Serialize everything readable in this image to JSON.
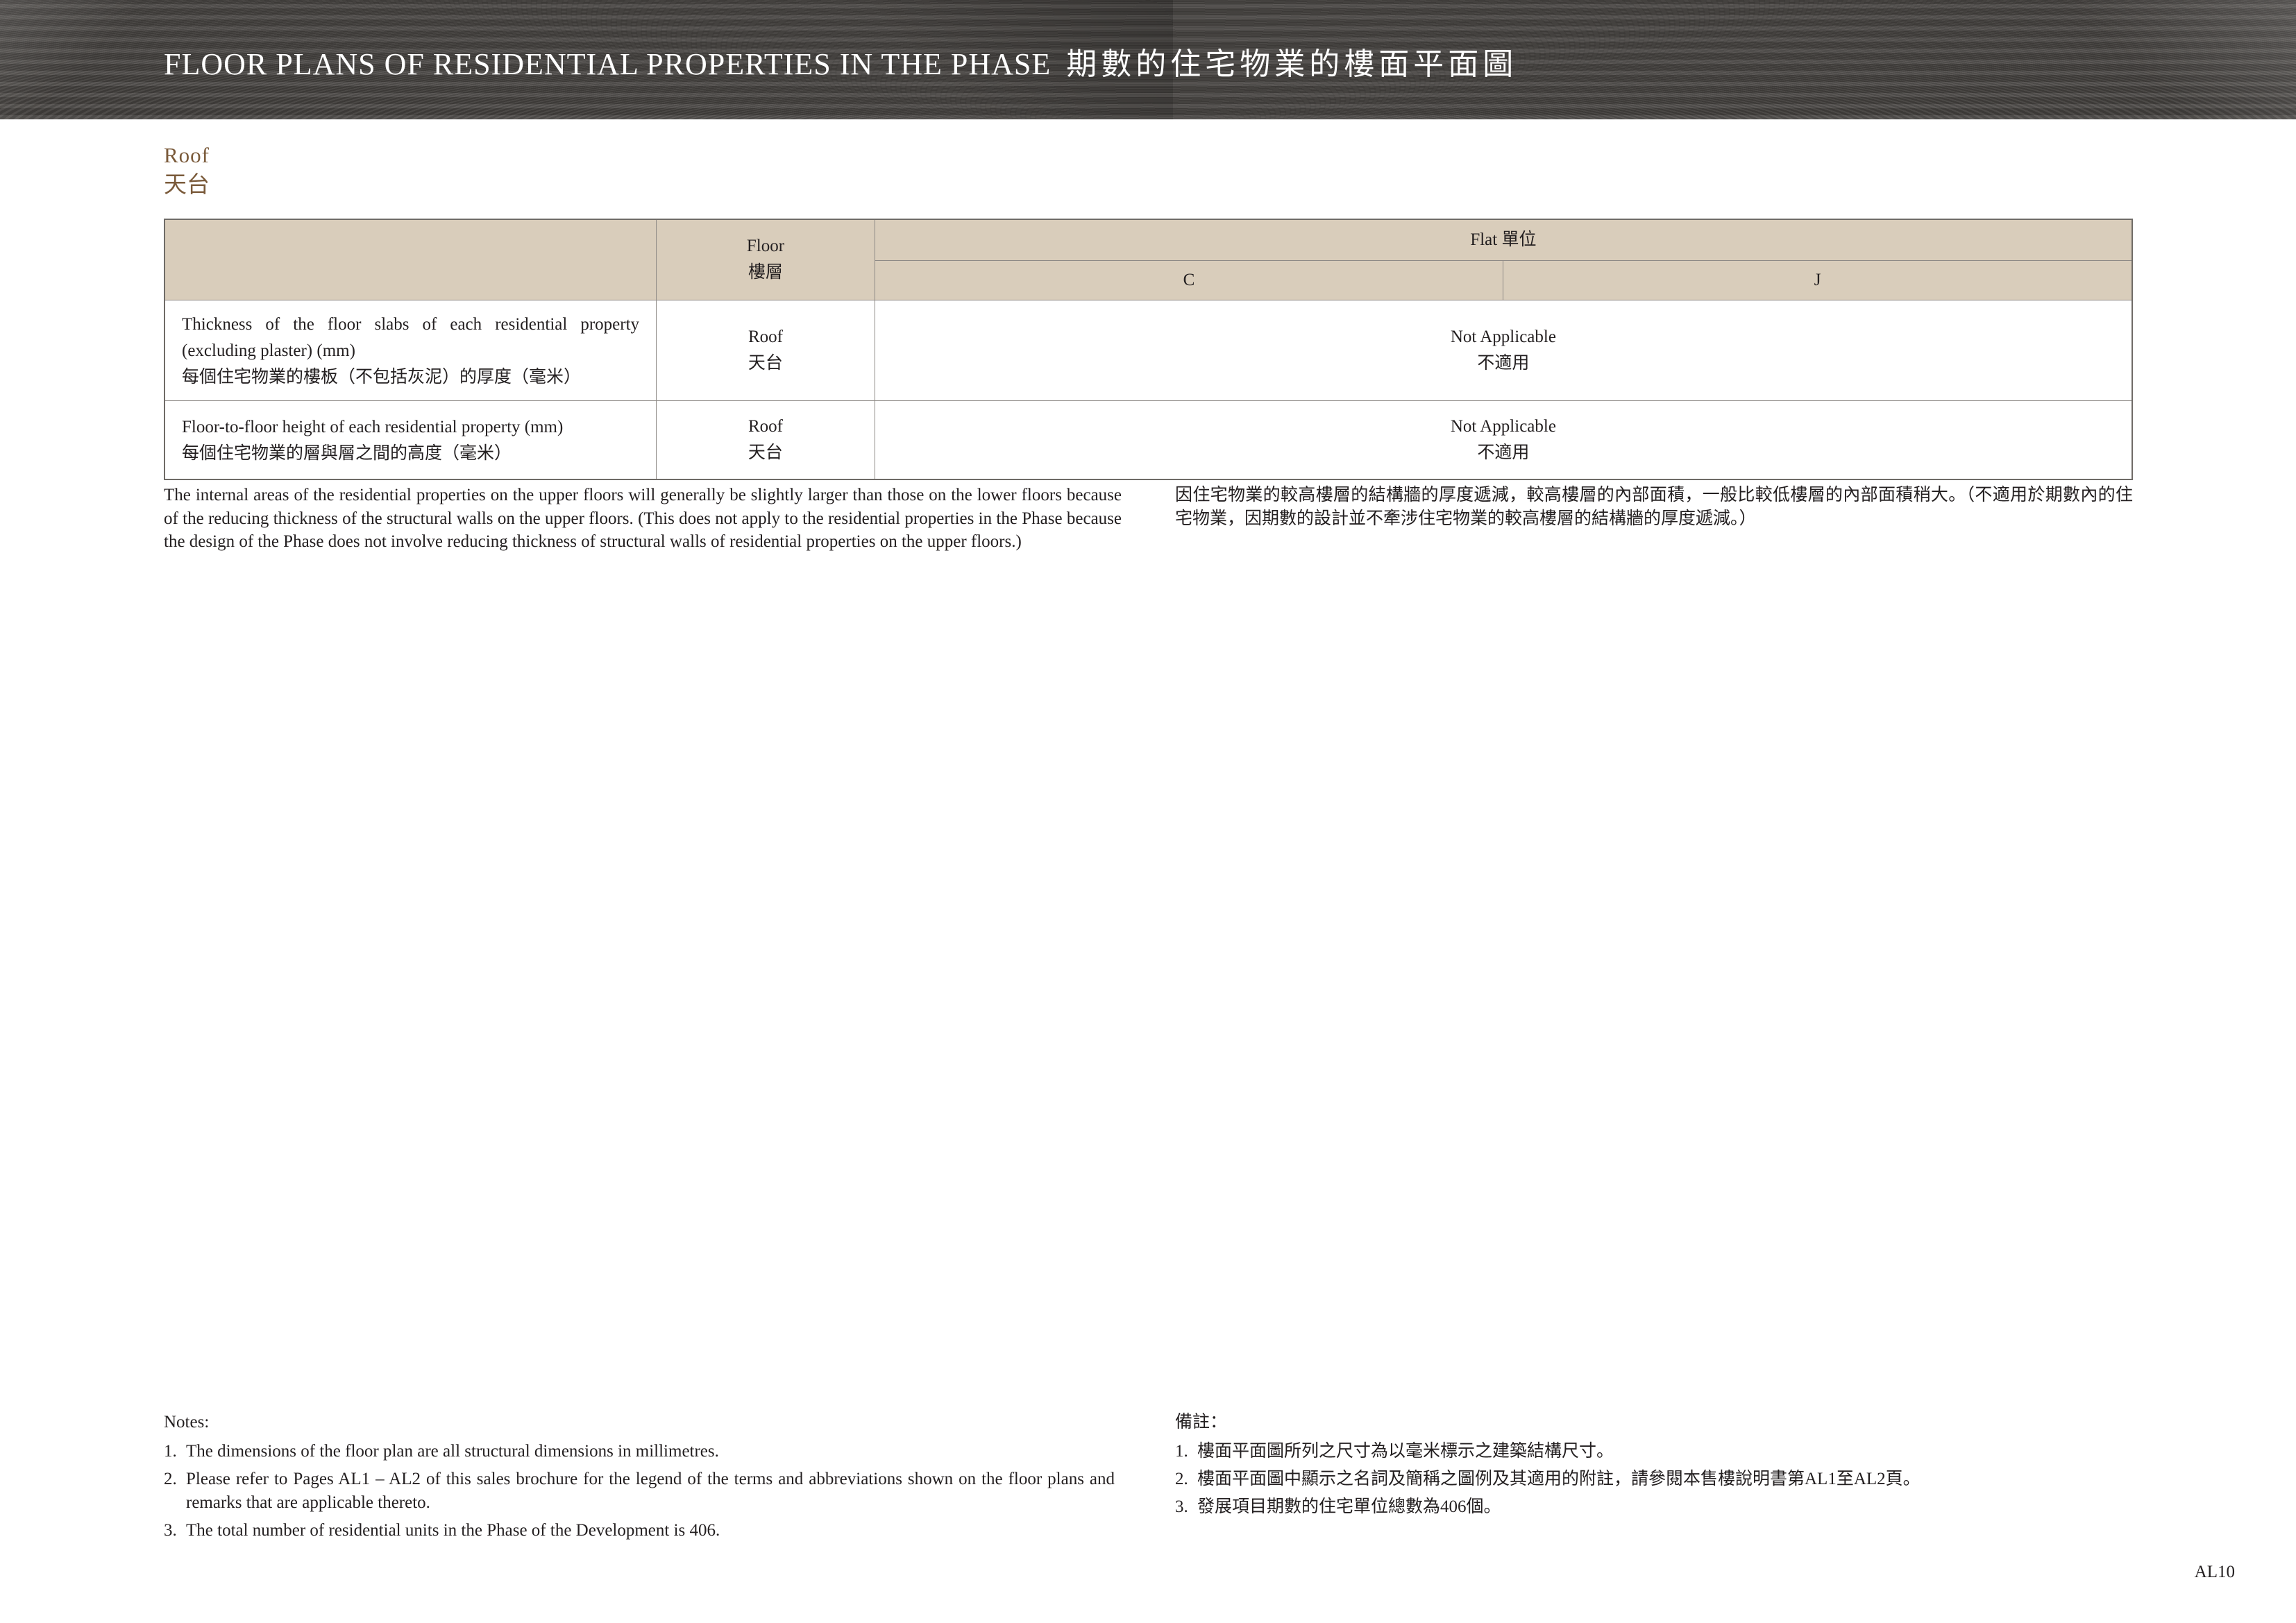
{
  "header": {
    "title_en": "FLOOR PLANS OF RESIDENTIAL PROPERTIES IN THE PHASE",
    "title_zh": "期數的住宅物業的樓面平面圖"
  },
  "section": {
    "title_en": "Roof",
    "title_zh": "天台"
  },
  "table": {
    "floor_header_en": "Floor",
    "floor_header_zh": "樓層",
    "flat_header": "Flat 單位",
    "flats": [
      "C",
      "J"
    ],
    "rows": [
      {
        "label_en": "Thickness of the floor slabs of each residential property (excluding plaster) (mm)",
        "label_zh": "每個住宅物業的樓板（不包括灰泥）的厚度（毫米）",
        "floor_en": "Roof",
        "floor_zh": "天台",
        "value_en": "Not Applicable",
        "value_zh": "不適用"
      },
      {
        "label_en": "Floor-to-floor height of each residential property (mm)",
        "label_zh": "每個住宅物業的層與層之間的高度（毫米）",
        "floor_en": "Roof",
        "floor_zh": "天台",
        "value_en": "Not Applicable",
        "value_zh": "不適用"
      }
    ]
  },
  "remark": {
    "en": "The internal areas of the residential properties on the upper floors will generally be slightly larger than those on the lower floors because of the reducing thickness of the structural walls on the upper floors. (This does not apply to the residential properties in the Phase because the design of the Phase does not involve reducing thickness of structural walls of residential properties on the upper floors.)",
    "zh": "因住宅物業的較高樓層的結構牆的厚度遞減，較高樓層的內部面積，一般比較低樓層的內部面積稍大。（不適用於期數內的住宅物業，因期數的設計並不牽涉住宅物業的較高樓層的結構牆的厚度遞減。）"
  },
  "notes": {
    "heading_en": "Notes:",
    "heading_zh": "備註：",
    "items_en": [
      {
        "num": "1.",
        "text": "The dimensions of the floor plan are all structural dimensions in millimetres."
      },
      {
        "num": "2.",
        "text": "Please refer to Pages AL1 – AL2 of this sales brochure for the legend of the terms and abbreviations shown on the floor plans and remarks that are applicable thereto."
      },
      {
        "num": "3.",
        "text": "The total number of residential units in the Phase of the Development is 406."
      }
    ],
    "items_zh": [
      {
        "num": "1.",
        "text": "樓面平面圖所列之尺寸為以毫米標示之建築結構尺寸。"
      },
      {
        "num": "2.",
        "text": "樓面平面圖中顯示之名詞及簡稱之圖例及其適用的附註，請參閱本售樓說明書第AL1至AL2頁。"
      },
      {
        "num": "3.",
        "text": "發展項目期數的住宅單位總數為406個。"
      }
    ]
  },
  "page_number": "AL10",
  "colors": {
    "banner": "#4a4744",
    "section_title": "#7a5a3a",
    "table_header": "#d9cdbb"
  }
}
